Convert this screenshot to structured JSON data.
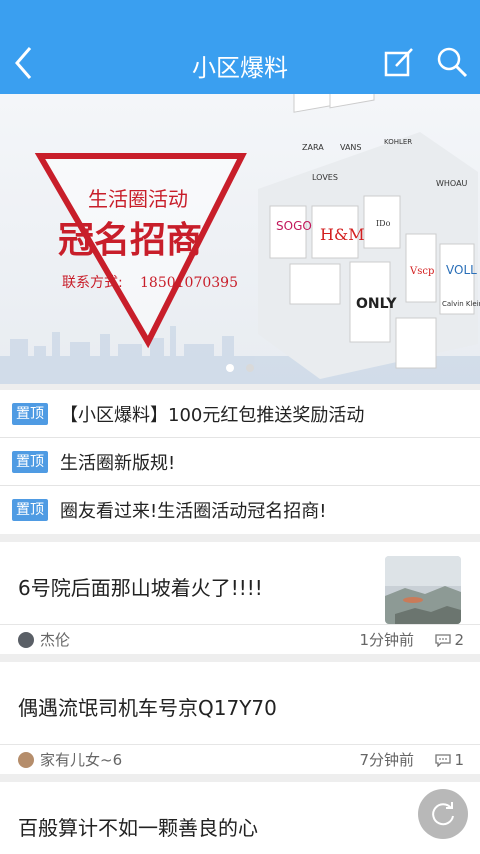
{
  "header": {
    "title": "小区爆料",
    "back_icon": "back-arrow-icon",
    "edit_icon": "compose-icon",
    "search_icon": "search-icon",
    "bg_color": "#3a9ff0"
  },
  "banner": {
    "line1": "生活圈活动",
    "line2": "冠名招商",
    "contact_label": "联系方式:",
    "contact_phone": "18501070395",
    "brand_labels": [
      "ZARA",
      "VANS",
      "KOHLER",
      "LOVES",
      "IDo",
      "WHOAU",
      "H&M",
      "Vscp",
      "VOLL",
      "ONLY",
      "Calvin Klein",
      "SOGO"
    ],
    "slide_count": 2,
    "active_slide": 1
  },
  "pinned": [
    {
      "badge": "置顶",
      "text": "【小区爆料】100元红包推送奖励活动"
    },
    {
      "badge": "置顶",
      "text": "生活圈新版规!"
    },
    {
      "badge": "置顶",
      "text": "圈友看过来!生活圈活动冠名招商!"
    }
  ],
  "posts": [
    {
      "title": "6号院后面那山坡着火了!!!!",
      "author": "杰伦",
      "time": "1分钟前",
      "comments": "2",
      "has_thumb": true
    },
    {
      "title": "偶遇流氓司机车号京Q17Y70",
      "author": "家有儿女~6",
      "time": "7分钟前",
      "comments": "1",
      "has_thumb": false
    },
    {
      "title": "百般算计不如一颗善良的心"
    }
  ],
  "fab_icon": "refresh-icon"
}
